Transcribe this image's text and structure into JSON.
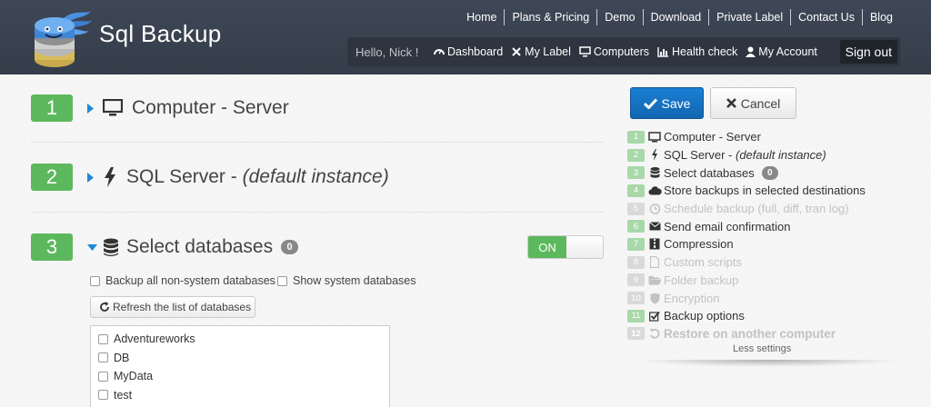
{
  "header": {
    "brand": "Sql Backup",
    "top_nav": [
      "Home",
      "Plans & Pricing",
      "Demo",
      "Download",
      "Private Label",
      "Contact Us",
      "Blog"
    ],
    "greeting": "Hello, Nick !",
    "user_nav": [
      {
        "label": "Dashboard",
        "icon": "dashboard-icon"
      },
      {
        "label": "My Label",
        "icon": "wrench-icon"
      },
      {
        "label": "Computers",
        "icon": "monitor-icon"
      },
      {
        "label": "Health check",
        "icon": "bar-chart-icon"
      },
      {
        "label": "My Account",
        "icon": "user-icon"
      }
    ],
    "sign_out": "Sign out"
  },
  "steps": [
    {
      "number": "1",
      "title": "Computer - Server",
      "icon": "monitor-icon"
    },
    {
      "number": "2",
      "title": "SQL Server - ",
      "title_italic": "(default instance)",
      "icon": "bolt-icon"
    },
    {
      "number": "3",
      "title": "Select databases",
      "icon": "database-icon",
      "badge": "0",
      "toggle": "ON"
    }
  ],
  "databases_panel": {
    "backup_all_label": "Backup all non-system databases",
    "show_system_label": "Show system databases",
    "refresh_label": "Refresh the list of databases",
    "databases": [
      "Adventureworks",
      "DB",
      "MyData",
      "test"
    ]
  },
  "sidebar": {
    "save_label": "Save",
    "cancel_label": "Cancel",
    "items": [
      {
        "n": "1",
        "label": "Computer - Server",
        "icon": "monitor-icon",
        "disabled": false
      },
      {
        "n": "2",
        "label": "SQL Server - ",
        "italic": "(default instance)",
        "icon": "bolt-icon",
        "disabled": false
      },
      {
        "n": "3",
        "label": "Select databases",
        "icon": "database-icon",
        "badge": "0",
        "disabled": false
      },
      {
        "n": "4",
        "label": "Store backups in selected destinations",
        "icon": "cloud-icon",
        "disabled": false
      },
      {
        "n": "5",
        "label": "Schedule backup (full, diff, tran log)",
        "icon": "alarm-clock-icon",
        "disabled": true
      },
      {
        "n": "6",
        "label": "Send email confirmation",
        "icon": "envelope-icon",
        "disabled": false
      },
      {
        "n": "7",
        "label": "Compression",
        "icon": "compress-icon",
        "disabled": false
      },
      {
        "n": "8",
        "label": "Custom scripts",
        "icon": "file-icon",
        "disabled": true
      },
      {
        "n": "9",
        "label": "Folder backup",
        "icon": "folder-open-icon",
        "disabled": true
      },
      {
        "n": "10",
        "label": "Encryption",
        "icon": "shield-icon",
        "disabled": true
      },
      {
        "n": "11",
        "label": "Backup options",
        "icon": "check-square-icon",
        "disabled": false
      },
      {
        "n": "12",
        "label": "Restore on another computer",
        "icon": "undo-icon",
        "disabled": true
      }
    ],
    "less_settings": "Less settings"
  },
  "colors": {
    "header_bg": "#3b4452",
    "step_green": "#5cb85c",
    "save_blue": "#1a7fd4",
    "caret_blue": "#1e88d8"
  }
}
